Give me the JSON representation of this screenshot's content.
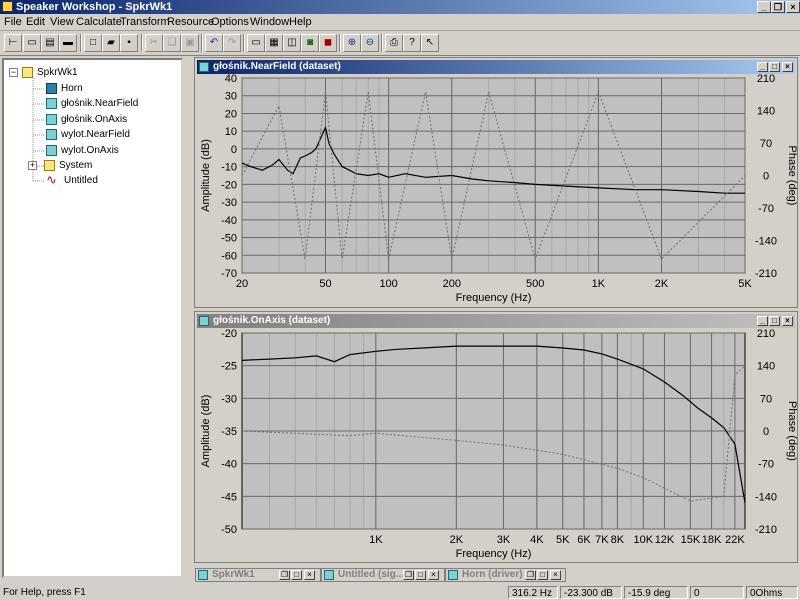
{
  "app": {
    "title": "Speaker Workshop - SpkrWk1"
  },
  "menu": [
    "File",
    "Edit",
    "View",
    "Calculate",
    "Transform",
    "Resource",
    "Options",
    "Window",
    "Help"
  ],
  "tree": {
    "root": "SpkrWk1",
    "items": [
      "Horn",
      "głośnik.NearField",
      "głośnik.OnAxis",
      "wylot.NearField",
      "wylot.OnAxis",
      "System",
      "Untitled"
    ]
  },
  "windows": {
    "nearfield": {
      "title": "głośnik.NearField (dataset)"
    },
    "onaxis": {
      "title": "głośnik.OnAxis (dataset)"
    }
  },
  "taskbar": [
    "SpkrWk1",
    "Untitled (sig...",
    "Horn (driver)"
  ],
  "status": {
    "help": "For Help, press F1",
    "freq": "316.2 Hz",
    "amp": "-23.300 dB",
    "phase": "-15.9 deg",
    "v1": "0",
    "v2": "0Ohms"
  },
  "chart_data": [
    {
      "type": "line",
      "xlabel": "Frequency (Hz)",
      "ylabel": "Amplitude (dB)",
      "y2label": "Phase (deg)",
      "xscale": "log",
      "xlim": [
        20,
        5000
      ],
      "ylim": [
        -70,
        40
      ],
      "y2lim": [
        -210,
        210
      ],
      "xticks": [
        "20",
        "50",
        "100",
        "200",
        "500",
        "1K",
        "2K",
        "5K"
      ],
      "yticks": [
        "40",
        "30",
        "20",
        "10",
        "0",
        "-10",
        "-20",
        "-30",
        "-40",
        "-50",
        "-60",
        "-70"
      ],
      "y2ticks": [
        "210",
        "140",
        "70",
        "0",
        "-70",
        "-140",
        "-210"
      ],
      "series": [
        {
          "kind": "amplitude",
          "x": [
            20,
            22,
            25,
            28,
            30,
            33,
            35,
            38,
            40,
            43,
            45,
            47,
            50,
            52,
            55,
            60,
            65,
            70,
            80,
            90,
            100,
            120,
            150,
            200,
            250,
            300,
            400,
            500,
            700,
            1000,
            1500,
            2000,
            3000,
            4000,
            5000
          ],
          "y": [
            -8,
            -10,
            -12,
            -9,
            -6,
            -12,
            -14,
            -5,
            -4,
            -2,
            0,
            5,
            12,
            3,
            -3,
            -10,
            -12,
            -14,
            -15,
            -14,
            -16,
            -14,
            -16,
            -15,
            -17,
            -18,
            -19,
            -20,
            -21,
            -22,
            -23,
            -23,
            -24,
            -25,
            -25
          ]
        },
        {
          "kind": "phase",
          "x": [
            20,
            30,
            40,
            50,
            60,
            80,
            100,
            150,
            200,
            300,
            500,
            1000,
            2000,
            5000
          ],
          "y": [
            0,
            150,
            -180,
            180,
            -180,
            180,
            -180,
            180,
            -180,
            180,
            -180,
            180,
            -180,
            0
          ]
        }
      ]
    },
    {
      "type": "line",
      "xlabel": "Frequency (Hz)",
      "ylabel": "Amplitude (dB)",
      "y2label": "Phase (deg)",
      "xscale": "log",
      "xlim": [
        316,
        24000
      ],
      "ylim": [
        -50,
        -20
      ],
      "y2lim": [
        -210,
        210
      ],
      "xticks": [
        "1K",
        "2K",
        "3K",
        "4K",
        "5K",
        "6K",
        "7K",
        "8K",
        "10K",
        "12K",
        "15K",
        "18K",
        "22K"
      ],
      "yticks": [
        "-20",
        "-25",
        "-30",
        "-35",
        "-40",
        "-45",
        "-50"
      ],
      "y2ticks": [
        "210",
        "140",
        "70",
        "0",
        "-70",
        "-140",
        "-210"
      ],
      "series": [
        {
          "kind": "amplitude",
          "x": [
            316,
            400,
            500,
            600,
            700,
            800,
            1000,
            1200,
            1500,
            2000,
            2500,
            3000,
            3500,
            4000,
            5000,
            6000,
            7000,
            8000,
            10000,
            12000,
            14000,
            16000,
            18000,
            20000,
            22000,
            24000
          ],
          "y": [
            -24.2,
            -24,
            -23.8,
            -23.5,
            -24.4,
            -23.3,
            -22.8,
            -22.5,
            -22.3,
            -22,
            -22,
            -22,
            -22,
            -22,
            -22.3,
            -22.6,
            -23.2,
            -24,
            -25.5,
            -27.5,
            -29.5,
            -31.5,
            -33,
            -34.5,
            -37,
            -46
          ]
        },
        {
          "kind": "phase",
          "x": [
            316,
            500,
            800,
            1000,
            2000,
            3000,
            5000,
            8000,
            10000,
            15000,
            20000,
            22000,
            24000
          ],
          "y": [
            0,
            -5,
            -10,
            -5,
            -20,
            -30,
            -50,
            -80,
            -100,
            -150,
            -140,
            120,
            140
          ]
        }
      ]
    }
  ]
}
